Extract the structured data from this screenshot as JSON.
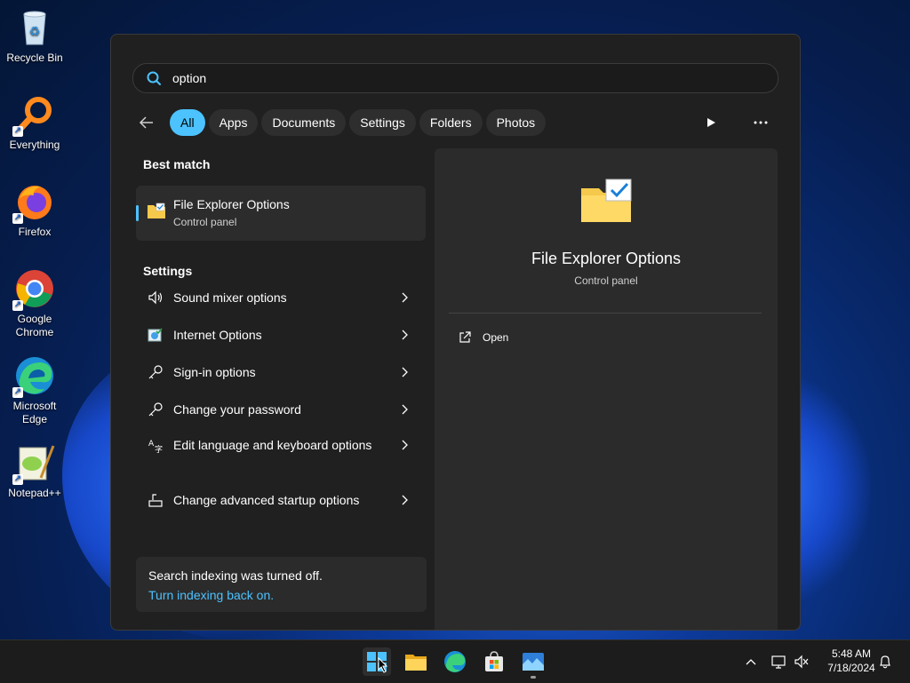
{
  "desktop": {
    "icons": [
      {
        "label": "Recycle Bin"
      },
      {
        "label": "Everything"
      },
      {
        "label": "Firefox"
      },
      {
        "label": "Google Chrome"
      },
      {
        "label": "Microsoft Edge"
      },
      {
        "label": "Notepad++"
      }
    ]
  },
  "search": {
    "value": "option",
    "filters": [
      "All",
      "Apps",
      "Documents",
      "Settings",
      "Folders",
      "Photos"
    ],
    "active_filter": "All"
  },
  "best_match": {
    "heading": "Best match",
    "title": "File Explorer Options",
    "subtitle": "Control panel"
  },
  "settings": {
    "heading": "Settings",
    "items": [
      {
        "label": "Sound mixer options",
        "icon": "speaker-icon"
      },
      {
        "label": "Internet Options",
        "icon": "internet-options-icon"
      },
      {
        "label": "Sign-in options",
        "icon": "key-icon"
      },
      {
        "label": "Change your password",
        "icon": "key-icon"
      },
      {
        "label": "Edit language and keyboard options",
        "icon": "language-icon"
      },
      {
        "label": "Change advanced startup options",
        "icon": "startup-icon"
      }
    ]
  },
  "indexing": {
    "message": "Search indexing was turned off.",
    "link": "Turn indexing back on."
  },
  "preview": {
    "title": "File Explorer Options",
    "subtitle": "Control panel",
    "actions": [
      {
        "label": "Open",
        "icon": "open-external-icon"
      }
    ]
  },
  "taskbar": {
    "apps": [
      "start-icon",
      "file-explorer-icon",
      "edge-icon",
      "store-icon",
      "photos-icon"
    ],
    "clock": {
      "time": "5:48 AM",
      "date": "7/18/2024"
    }
  },
  "colors": {
    "accent": "#4cc2ff",
    "panel": "#202020",
    "card": "#2b2b2b"
  }
}
